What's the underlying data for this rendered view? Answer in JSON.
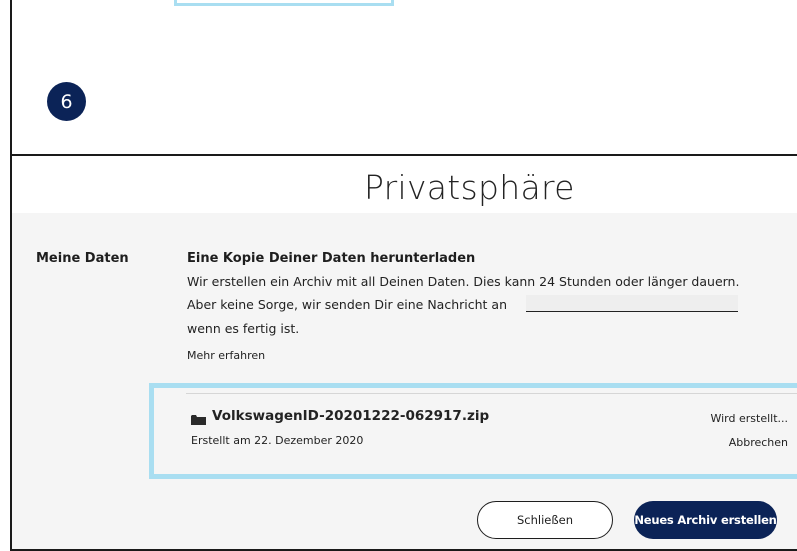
{
  "step": {
    "number": "6"
  },
  "modal": {
    "title": "Privatsphäre",
    "section_label": "Meine Daten",
    "heading": "Eine Kopie Deiner Daten herunterladen",
    "desc_line1": "Wir erstellen ein Archiv mit all Deinen Daten. Dies kann 24 Stunden oder länger dauern.",
    "desc_line2": "Aber keine Sorge, wir senden Dir eine Nachricht an",
    "desc_line3": "wenn es fertig ist.",
    "learn_more": "Mehr erfahren",
    "archive": {
      "file_name": "VolkswagenID-20201222-062917.zip",
      "created_at": "Erstellt am 22. Dezember 2020",
      "status": "Wird erstellt...",
      "cancel_label": "Abbrechen",
      "icon": "folder-icon"
    },
    "buttons": {
      "close_label": "Schließen",
      "new_archive_label": "Neues Archiv erstellen"
    }
  },
  "colors": {
    "navy": "#0b2357",
    "highlight": "#a9def1",
    "body_bg": "#f5f5f5"
  }
}
